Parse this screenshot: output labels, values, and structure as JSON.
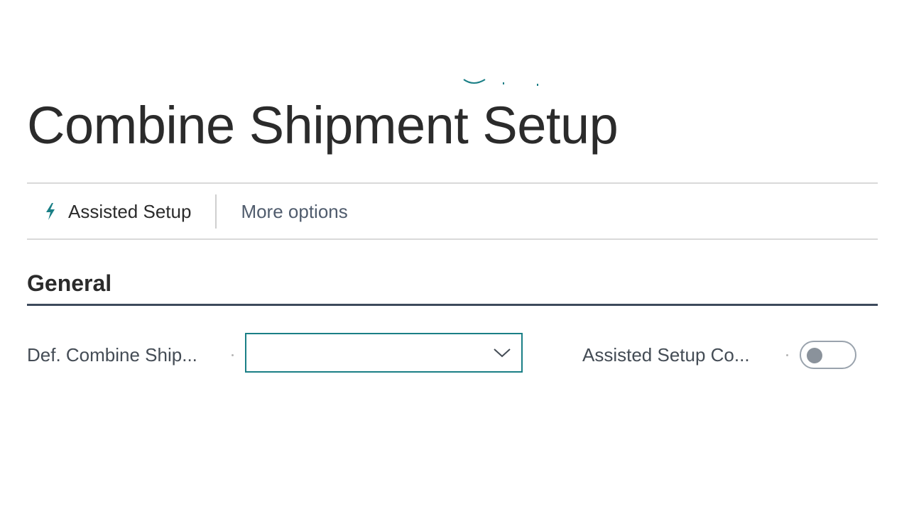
{
  "page": {
    "title": "Combine Shipment Setup"
  },
  "actions": {
    "assisted_setup": {
      "label": "Assisted Setup",
      "icon": "lightning-icon"
    },
    "more_options": {
      "label": "More options"
    }
  },
  "section": {
    "title": "General"
  },
  "fields": {
    "def_combine_shipment": {
      "label": "Def. Combine Ship...",
      "value": "",
      "icon": "chevron-down-icon"
    },
    "assisted_setup_completed": {
      "label": "Assisted Setup Co...",
      "checked": false
    }
  },
  "colors": {
    "accent": "#1a7f86",
    "section_rule": "#3d4a5c",
    "link_text": "#505c6d"
  }
}
